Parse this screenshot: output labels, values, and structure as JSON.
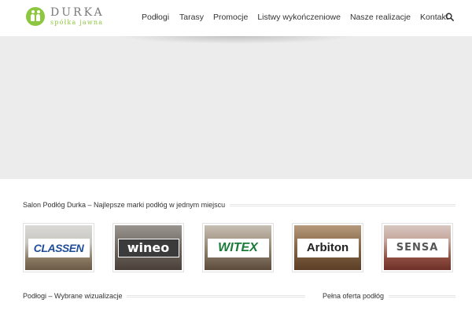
{
  "header": {
    "logo": {
      "name": "DURKA",
      "subtitle": "spółka jawna"
    },
    "nav": [
      "Podłogi",
      "Tarasy",
      "Promocje",
      "Listwy wykończeniowe",
      "Nasze realizacje",
      "Kontakt"
    ],
    "search_icon": "search-icon"
  },
  "slider": {
    "background": "#ececec"
  },
  "brands_section": {
    "title": "Salon Podłóg Durka – Najlepsze marki podłóg w jednym miejscu",
    "brands": [
      "CLASSEN",
      "wineo",
      "WITEX",
      "Arbiton",
      "SENSA"
    ]
  },
  "visualizations_section": {
    "title": "Podłogi – Wybrane wizualizacje"
  },
  "offer_section": {
    "title": "Pełna oferta podłóg"
  },
  "colors": {
    "accent": "#8dc63f",
    "text": "#333333"
  }
}
